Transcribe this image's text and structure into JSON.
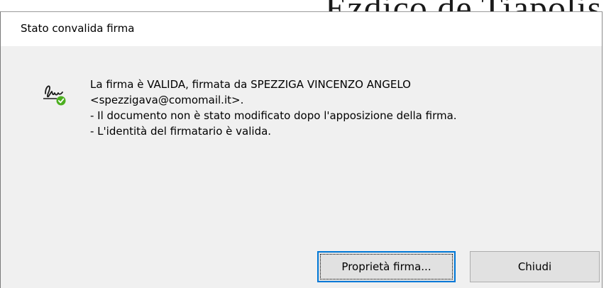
{
  "background": {
    "document_text": "Ezdico de Tiapolis"
  },
  "dialog": {
    "title": "Stato convalida firma",
    "icon": "signature-valid-icon",
    "message_lines": [
      "La firma è VALIDA, firmata da SPEZZIGA VINCENZO ANGELO",
      "<spezzigava@comomail.it>.",
      "- Il documento non è stato modificato dopo l'apposizione della firma.",
      "- L'identità del firmatario è valida."
    ],
    "buttons": {
      "properties_label": "Proprietà firma...",
      "close_label": "Chiudi"
    },
    "colors": {
      "focus_border": "#0078d7",
      "valid_check": "#4caf20"
    }
  }
}
